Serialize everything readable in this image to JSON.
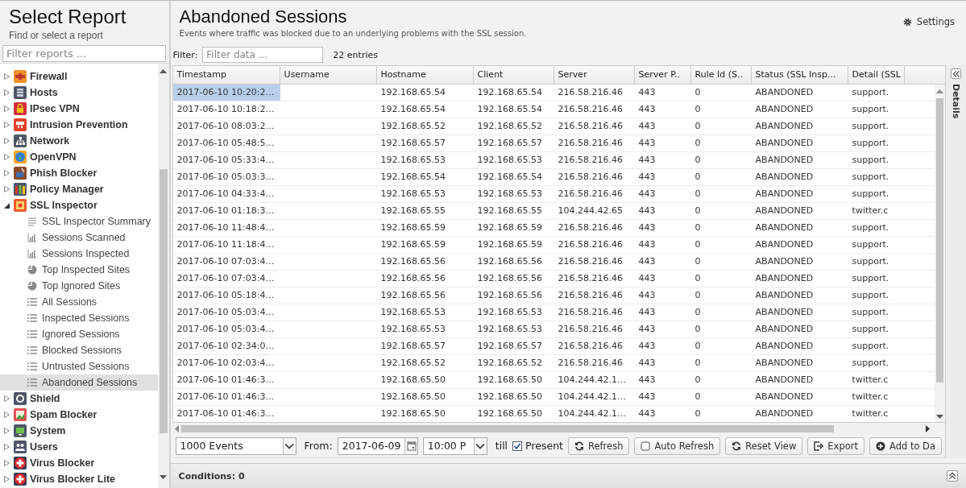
{
  "left_panel": {
    "title": "Select Report",
    "subtitle": "Find or select a report",
    "filter": {
      "placeholder": "Filter reports ..."
    },
    "tree": [
      {
        "label": "Firewall",
        "expanded": false,
        "selected": false
      },
      {
        "label": "Hosts",
        "expanded": false,
        "selected": false
      },
      {
        "label": "IPsec VPN",
        "expanded": false,
        "selected": false
      },
      {
        "label": "Intrusion Prevention",
        "expanded": false,
        "selected": false
      },
      {
        "label": "Network",
        "expanded": false,
        "selected": false
      },
      {
        "label": "OpenVPN",
        "expanded": false,
        "selected": false
      },
      {
        "label": "Phish Blocker",
        "expanded": false,
        "selected": false
      },
      {
        "label": "Policy Manager",
        "expanded": false,
        "selected": false
      },
      {
        "label": "SSL Inspector",
        "expanded": true,
        "selected": false,
        "children": [
          {
            "label": "SSL Inspector Summary",
            "kind": "text",
            "selected": false
          },
          {
            "label": "Sessions Scanned",
            "kind": "bar",
            "selected": false
          },
          {
            "label": "Sessions Inspected",
            "kind": "bar",
            "selected": false
          },
          {
            "label": "Top Inspected Sites",
            "kind": "pie",
            "selected": false
          },
          {
            "label": "Top Ignored Sites",
            "kind": "pie",
            "selected": false
          },
          {
            "label": "All Sessions",
            "kind": "list",
            "selected": false
          },
          {
            "label": "Inspected Sessions",
            "kind": "list",
            "selected": false
          },
          {
            "label": "Ignored Sessions",
            "kind": "list",
            "selected": false
          },
          {
            "label": "Blocked Sessions",
            "kind": "list",
            "selected": false
          },
          {
            "label": "Untrusted Sessions",
            "kind": "list",
            "selected": false
          },
          {
            "label": "Abandoned Sessions",
            "kind": "list",
            "selected": true
          }
        ]
      },
      {
        "label": "Shield",
        "expanded": false,
        "selected": false
      },
      {
        "label": "Spam Blocker",
        "expanded": false,
        "selected": false
      },
      {
        "label": "System",
        "expanded": false,
        "selected": false
      },
      {
        "label": "Users",
        "expanded": false,
        "selected": false
      },
      {
        "label": "Virus Blocker",
        "expanded": false,
        "selected": false
      },
      {
        "label": "Virus Blocker Lite",
        "expanded": false,
        "selected": false
      }
    ]
  },
  "report": {
    "title": "Abandoned Sessions",
    "description": "Events where traffic was blocked due to an underlying problems with the SSL session.",
    "settings_button": "Settings",
    "filter_label": "Filter:",
    "filter": {
      "placeholder": "Filter data ..."
    },
    "entry_count": "22 entries"
  },
  "table": {
    "columns": [
      "Timestamp",
      "Username",
      "Hostname",
      "Client",
      "Server",
      "Server P..",
      "Rule Id (S..",
      "Status (SSL Insp...",
      "Detail (SSL"
    ],
    "rows": [
      {
        "timestamp": "2017-06-10 10:20:2…",
        "hostname": "192.168.65.54",
        "client": "192.168.65.54",
        "server": "216.58.216.46",
        "port": "443",
        "rule": "0",
        "status": "ABANDONED",
        "detail": "support.",
        "selected": true
      },
      {
        "timestamp": "2017-06-10 10:18:2…",
        "hostname": "192.168.65.54",
        "client": "192.168.65.54",
        "server": "216.58.216.46",
        "port": "443",
        "rule": "0",
        "status": "ABANDONED",
        "detail": "support.",
        "selected": false
      },
      {
        "timestamp": "2017-06-10 08:03:2…",
        "hostname": "192.168.65.52",
        "client": "192.168.65.52",
        "server": "216.58.216.46",
        "port": "443",
        "rule": "0",
        "status": "ABANDONED",
        "detail": "support.",
        "selected": false
      },
      {
        "timestamp": "2017-06-10 05:48:5…",
        "hostname": "192.168.65.57",
        "client": "192.168.65.57",
        "server": "216.58.216.46",
        "port": "443",
        "rule": "0",
        "status": "ABANDONED",
        "detail": "support.",
        "selected": false
      },
      {
        "timestamp": "2017-06-10 05:33:4…",
        "hostname": "192.168.65.53",
        "client": "192.168.65.53",
        "server": "216.58.216.46",
        "port": "443",
        "rule": "0",
        "status": "ABANDONED",
        "detail": "support.",
        "selected": false
      },
      {
        "timestamp": "2017-06-10 05:03:3…",
        "hostname": "192.168.65.54",
        "client": "192.168.65.54",
        "server": "216.58.216.46",
        "port": "443",
        "rule": "0",
        "status": "ABANDONED",
        "detail": "support.",
        "selected": false
      },
      {
        "timestamp": "2017-06-10 04:33:4…",
        "hostname": "192.168.65.53",
        "client": "192.168.65.53",
        "server": "216.58.216.46",
        "port": "443",
        "rule": "0",
        "status": "ABANDONED",
        "detail": "support.",
        "selected": false
      },
      {
        "timestamp": "2017-06-10 01:18:3…",
        "hostname": "192.168.65.55",
        "client": "192.168.65.55",
        "server": "104.244.42.65",
        "port": "443",
        "rule": "0",
        "status": "ABANDONED",
        "detail": "twitter.c",
        "selected": false
      },
      {
        "timestamp": "2017-06-10 11:48:4…",
        "hostname": "192.168.65.59",
        "client": "192.168.65.59",
        "server": "216.58.216.46",
        "port": "443",
        "rule": "0",
        "status": "ABANDONED",
        "detail": "support.",
        "selected": false
      },
      {
        "timestamp": "2017-06-10 11:18:4…",
        "hostname": "192.168.65.59",
        "client": "192.168.65.59",
        "server": "216.58.216.46",
        "port": "443",
        "rule": "0",
        "status": "ABANDONED",
        "detail": "support.",
        "selected": false
      },
      {
        "timestamp": "2017-06-10 07:03:4…",
        "hostname": "192.168.65.56",
        "client": "192.168.65.56",
        "server": "216.58.216.46",
        "port": "443",
        "rule": "0",
        "status": "ABANDONED",
        "detail": "support.",
        "selected": false
      },
      {
        "timestamp": "2017-06-10 07:03:4…",
        "hostname": "192.168.65.56",
        "client": "192.168.65.56",
        "server": "216.58.216.46",
        "port": "443",
        "rule": "0",
        "status": "ABANDONED",
        "detail": "support.",
        "selected": false
      },
      {
        "timestamp": "2017-06-10 05:18:4…",
        "hostname": "192.168.65.56",
        "client": "192.168.65.56",
        "server": "216.58.216.46",
        "port": "443",
        "rule": "0",
        "status": "ABANDONED",
        "detail": "support.",
        "selected": false
      },
      {
        "timestamp": "2017-06-10 05:03:4…",
        "hostname": "192.168.65.53",
        "client": "192.168.65.53",
        "server": "216.58.216.46",
        "port": "443",
        "rule": "0",
        "status": "ABANDONED",
        "detail": "support.",
        "selected": false
      },
      {
        "timestamp": "2017-06-10 05:03:4…",
        "hostname": "192.168.65.53",
        "client": "192.168.65.53",
        "server": "216.58.216.46",
        "port": "443",
        "rule": "0",
        "status": "ABANDONED",
        "detail": "support.",
        "selected": false
      },
      {
        "timestamp": "2017-06-10 02:34:0…",
        "hostname": "192.168.65.57",
        "client": "192.168.65.57",
        "server": "216.58.216.46",
        "port": "443",
        "rule": "0",
        "status": "ABANDONED",
        "detail": "support.",
        "selected": false
      },
      {
        "timestamp": "2017-06-10 02:03:4…",
        "hostname": "192.168.65.52",
        "client": "192.168.65.52",
        "server": "216.58.216.46",
        "port": "443",
        "rule": "0",
        "status": "ABANDONED",
        "detail": "support.",
        "selected": false
      },
      {
        "timestamp": "2017-06-10 01:46:3…",
        "hostname": "192.168.65.50",
        "client": "192.168.65.50",
        "server": "104.244.42.1…",
        "port": "443",
        "rule": "0",
        "status": "ABANDONED",
        "detail": "twitter.c",
        "selected": false
      },
      {
        "timestamp": "2017-06-10 01:46:3…",
        "hostname": "192.168.65.50",
        "client": "192.168.65.50",
        "server": "104.244.42.1…",
        "port": "443",
        "rule": "0",
        "status": "ABANDONED",
        "detail": "twitter.c",
        "selected": false
      },
      {
        "timestamp": "2017-06-10 01:46:3…",
        "hostname": "192.168.65.50",
        "client": "192.168.65.50",
        "server": "104.244.42.1…",
        "port": "443",
        "rule": "0",
        "status": "ABANDONED",
        "detail": "twitter.c",
        "selected": false
      }
    ]
  },
  "details_panel": {
    "label": "Details"
  },
  "toolbar": {
    "limit": "1000 Events",
    "from_label": "From:",
    "from_date": "2017-06-09",
    "from_time": "10:00 P",
    "till_label": "till",
    "present": {
      "label": "Present",
      "checked": true
    },
    "buttons": [
      {
        "label": "Refresh",
        "kind": "refresh"
      },
      {
        "label": "Auto Refresh",
        "kind": "checkbox",
        "checked": false
      },
      {
        "label": "Reset View",
        "kind": "refresh"
      },
      {
        "label": "Export",
        "kind": "export"
      },
      {
        "label": "Add to Da",
        "kind": "add"
      }
    ]
  },
  "conditions": {
    "label": "Conditions: 0"
  }
}
